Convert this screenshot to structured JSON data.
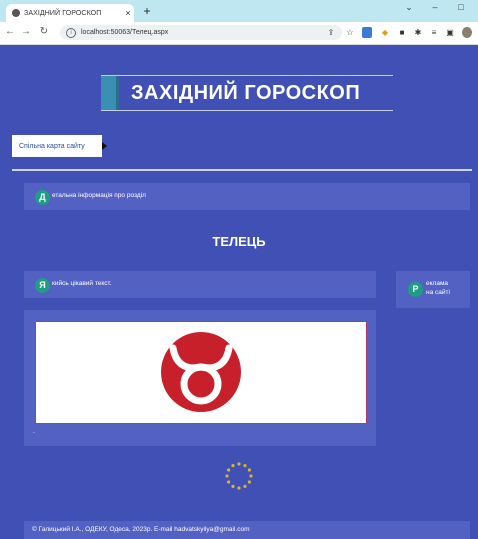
{
  "browser": {
    "tab_title": "ЗАХІДНИЙ ГОРОСКОП",
    "tab_close": "×",
    "new_tab": "+",
    "url": "localhost:50063/Телец.aspx",
    "win_min": "⌄",
    "win_minimize": "–",
    "win_max": "□"
  },
  "header": {
    "logo_text": "ЗАХІДНИЙ ГОРОСКОП",
    "sitemap_label": "Спільна карта сайту"
  },
  "section_info": {
    "badge": "Д",
    "text": "етальна інформація про розділ"
  },
  "title": "ТЕЛЕЦЬ",
  "content": {
    "badge": "Я",
    "text": "кийсь цікавий текст.",
    "caption": "."
  },
  "ads": {
    "badge": "Р",
    "line1": "еклама",
    "line2": "на сайті"
  },
  "footer": {
    "text": "© Галицький І.А., ОДЕКУ, Одеса, 2023р. E-mail hadvatskyilya@gmail.com"
  },
  "colors": {
    "page_bg": "#4150b5",
    "panel_bg": "#5362c2",
    "badge": "#1e9e84",
    "taurus_red": "#c8202a"
  }
}
